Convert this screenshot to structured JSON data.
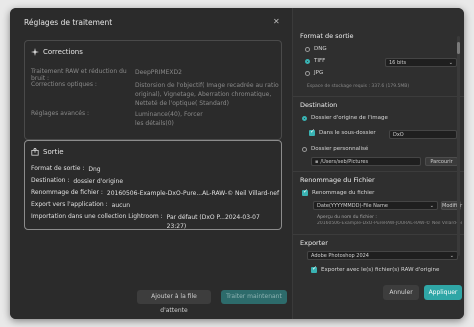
{
  "dialog": {
    "title": "Réglages de traitement"
  },
  "corrections": {
    "header": "Corrections",
    "rows": [
      {
        "label": "Traitement RAW et réduction du bruit :",
        "value_lines": [
          "DeepPRIMEXD2"
        ]
      },
      {
        "label": "Corrections optiques :",
        "value_lines": [
          "Distorsion de l'objectif( Image recadrée au ratio",
          "original), Vignetage, Aberration chromatique,",
          "Netteté de l'optique( Standard)"
        ]
      },
      {
        "label": "Réglages avancés :",
        "value_lines": [
          "Luminance(40), Forcer",
          "les détails(0)"
        ]
      }
    ]
  },
  "sortie": {
    "header": "Sortie",
    "rows": [
      {
        "label": "Format de sortie :",
        "value": "Dng"
      },
      {
        "label": "Destination :",
        "value": "dossier d'origine"
      },
      {
        "label": "Renommage de fichier :",
        "value": "20160506-Example-DxO-Pure...AL-RAW-© Neil Villard-nef"
      },
      {
        "label": "Export vers l'application :",
        "value": "aucun"
      },
      {
        "label": "Importation dans une collection Lightroom :",
        "value": "Par défaut (DxO P...2024-03-07 23:27)"
      }
    ]
  },
  "buttons": {
    "queue": "Ajouter à la file d'attente",
    "process_now": "Traiter maintenant",
    "cancel": "Annuler",
    "apply": "Appliquer"
  },
  "format_sortie": {
    "title": "Format de sortie",
    "options": [
      {
        "label": "DNG",
        "selected": false
      },
      {
        "label": "TIFF",
        "selected": true
      },
      {
        "label": "JPG",
        "selected": false
      }
    ],
    "bit_depth": "16 bits",
    "disk_space": "Espace de stockage requis : 337.6 (179.5MB)"
  },
  "destination": {
    "title": "Destination",
    "origin_label": "Dossier d'origine de l'image",
    "subfolder_label": "Dans le sous-dossier",
    "subfolder_value": "DxO",
    "custom_label": "Dossier personnalisé",
    "custom_path": "/Users/seb/Pictures",
    "browse_label": "Parcourir"
  },
  "renommage": {
    "title": "Renommage du Fichier",
    "checkbox_label": "Renommage du fichier",
    "pattern_value": "Date(YYYYMMDD)-File Name",
    "modify_label": "Modifier",
    "preview_label": "Aperçu du nom du fichier :",
    "preview_value": "20160506-Example-DxO-PureRAW-JOURAL-RAW-© Neil Villard-nef"
  },
  "exporter": {
    "title": "Exporter",
    "app_value": "Adobe Photoshop 2024",
    "export_label": "Exporter avec le(s) fichier(s) RAW d'origine"
  },
  "colors": {
    "accent": "#2fa6a6",
    "background": "#2e2e2e"
  }
}
